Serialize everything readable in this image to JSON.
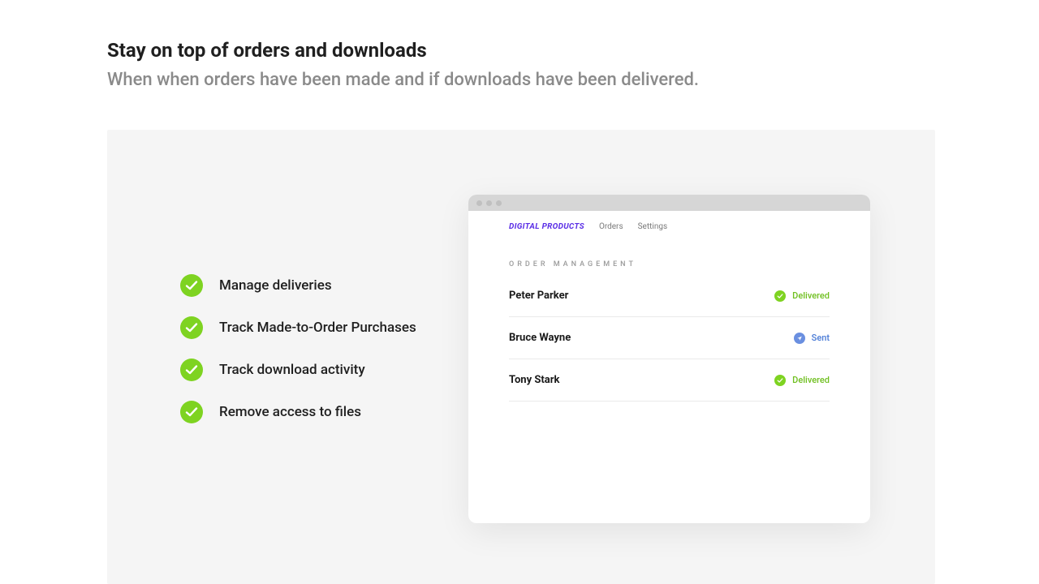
{
  "header": {
    "title": "Stay on top of orders and downloads",
    "subtitle": "When when orders have been made and if downloads have been delivered."
  },
  "features": [
    {
      "label": "Manage deliveries"
    },
    {
      "label": "Track Made-to-Order Purchases"
    },
    {
      "label": "Track download activity"
    },
    {
      "label": "Remove access to files"
    }
  ],
  "app": {
    "nav": {
      "brand": "DIGITAL PRODUCTS",
      "links": [
        "Orders",
        "Settings"
      ]
    },
    "section_label": "ORDER MANAGEMENT",
    "orders": [
      {
        "name": "Peter Parker",
        "status": "Delivered",
        "status_kind": "delivered"
      },
      {
        "name": "Bruce Wayne",
        "status": "Sent",
        "status_kind": "sent"
      },
      {
        "name": "Tony Stark",
        "status": "Delivered",
        "status_kind": "delivered"
      }
    ]
  }
}
